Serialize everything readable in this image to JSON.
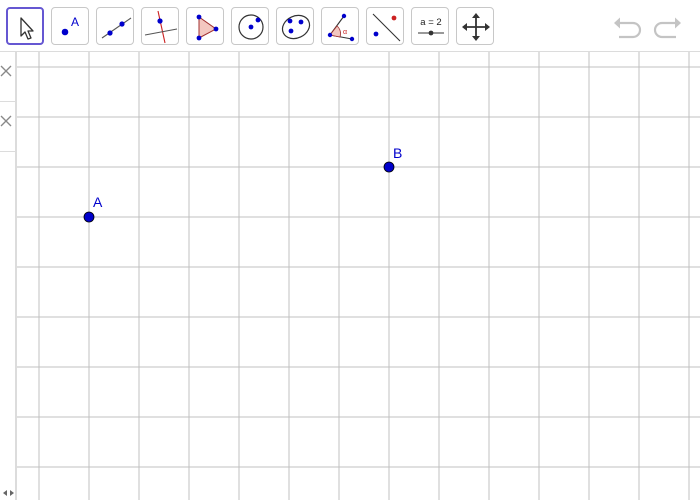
{
  "toolbar": {
    "tools": [
      {
        "id": "move",
        "name": "move-tool-button",
        "active": true
      },
      {
        "id": "point",
        "name": "point-tool-button",
        "label": "A"
      },
      {
        "id": "line",
        "name": "line-tool-button"
      },
      {
        "id": "perpendicular",
        "name": "perpendicular-line-tool-button"
      },
      {
        "id": "polygon",
        "name": "polygon-tool-button"
      },
      {
        "id": "circle",
        "name": "circle-tool-button"
      },
      {
        "id": "conic",
        "name": "conic-tool-button"
      },
      {
        "id": "angle",
        "name": "angle-tool-button",
        "label": "α"
      },
      {
        "id": "reflect",
        "name": "reflect-tool-button"
      },
      {
        "id": "slider",
        "name": "slider-tool-button",
        "label": "a = 2"
      },
      {
        "id": "move-view",
        "name": "move-graphics-view-tool-button"
      }
    ],
    "undo_icon": "undo-icon",
    "redo_icon": "redo-icon"
  },
  "algebra": {
    "rows": [
      {
        "icon": "close-icon"
      },
      {
        "icon": "close-icon"
      }
    ]
  },
  "points": [
    {
      "label": "A",
      "color": "#0000cc"
    },
    {
      "label": "B",
      "color": "#0000cc"
    }
  ],
  "colors": {
    "accent": "#6557d2",
    "point": "#0000cc",
    "grid": "#c0c0c0"
  }
}
